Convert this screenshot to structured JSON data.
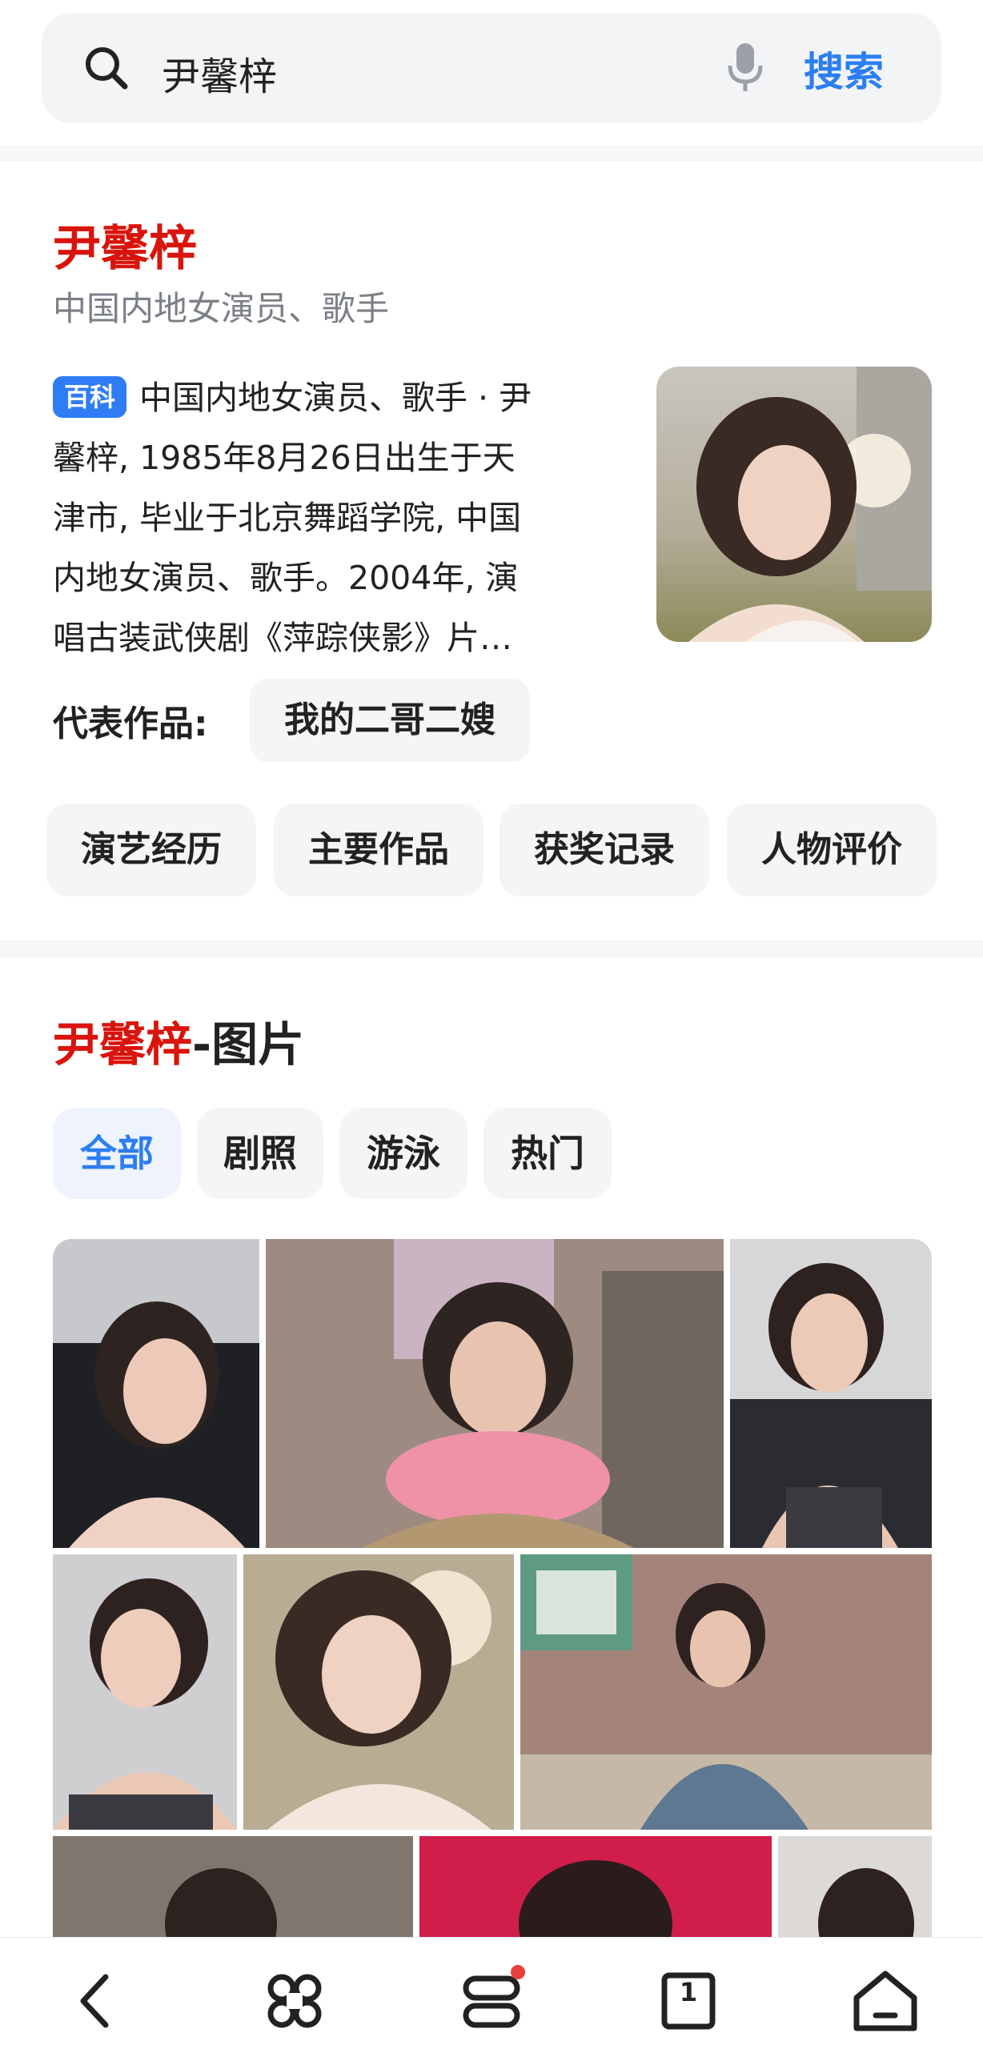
{
  "search": {
    "query": "尹馨梓",
    "button": "搜索"
  },
  "knowledge_card": {
    "name": "尹馨梓",
    "subtitle": "中国内地女演员、歌手",
    "badge": "百科",
    "intro_lines": [
      "中国内地女演员、歌手 · 尹",
      "馨梓, 1985年8月26日出生于天",
      "津市, 毕业于北京舞蹈学院, 中国",
      "内地女演员、歌手。2004年, 演",
      "唱古装武侠剧《萍踪侠影》片…"
    ],
    "works_label": "代表作品:",
    "works": [
      "我的二哥二嫂"
    ],
    "tabs": [
      "演艺经历",
      "主要作品",
      "获奖记录",
      "人物评价"
    ]
  },
  "images_section": {
    "title_name": "尹馨梓",
    "title_suffix": "-图片",
    "filters": [
      "全部",
      "剧照",
      "游泳",
      "热门"
    ],
    "active_filter": 0
  },
  "bottom_nav": {
    "items": [
      "back-icon",
      "shortcut-icon",
      "menu-icon",
      "tabs-icon",
      "home-icon"
    ],
    "tab_count": "1",
    "accent": "#2c7ef2",
    "brand_red": "#d9140c"
  }
}
